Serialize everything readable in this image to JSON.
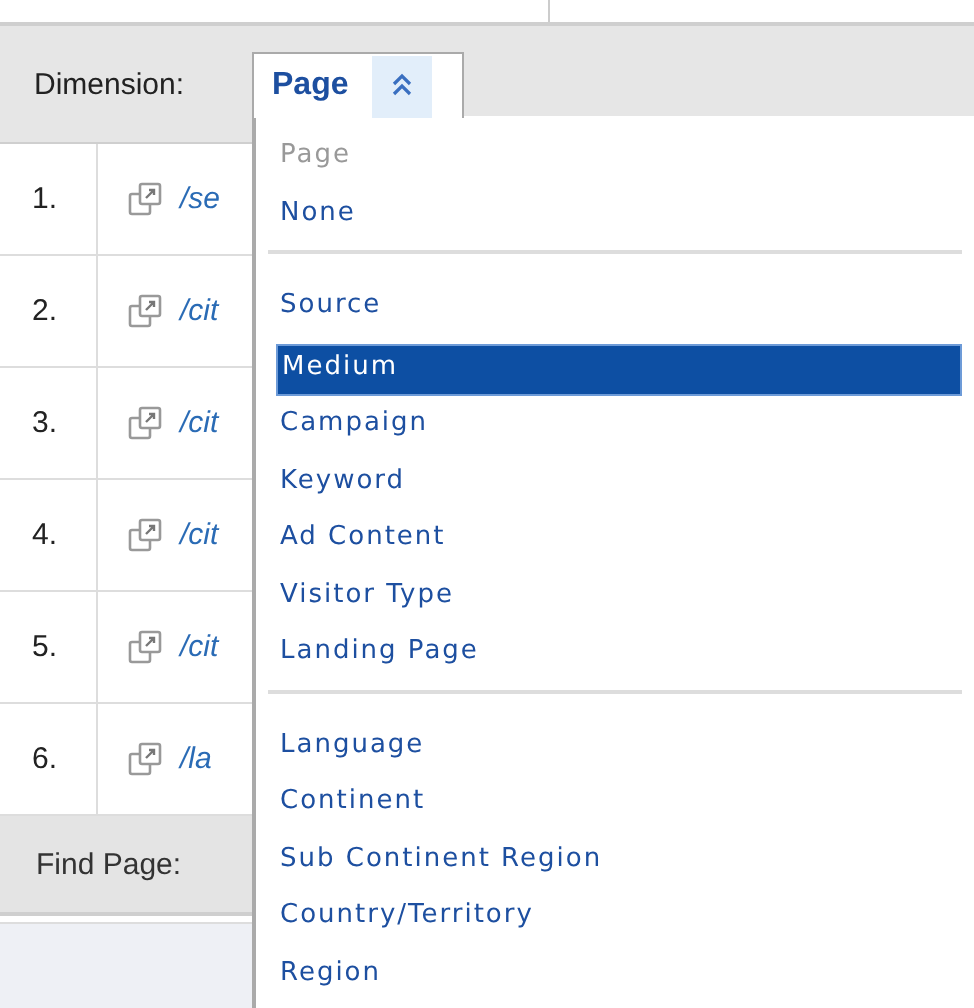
{
  "dimension_bar": {
    "label": "Dimension:",
    "dropdown": {
      "value": "Page",
      "expanded": true
    }
  },
  "table": {
    "rows": [
      {
        "number": "1.",
        "link": "/se"
      },
      {
        "number": "2.",
        "link": "/cit"
      },
      {
        "number": "3.",
        "link": "/cit"
      },
      {
        "number": "4.",
        "link": "/cit"
      },
      {
        "number": "5.",
        "link": "/cit"
      },
      {
        "number": "6.",
        "link": "/la"
      }
    ]
  },
  "find_bar": {
    "label": "Find Page:"
  },
  "menu": {
    "groups": [
      [
        {
          "label": "Page",
          "selected": false,
          "disabled": true
        },
        {
          "label": "None",
          "selected": false,
          "disabled": false
        }
      ],
      [
        {
          "label": "Source",
          "selected": false,
          "disabled": false
        },
        {
          "label": "Medium",
          "selected": true,
          "disabled": false
        },
        {
          "label": "Campaign",
          "selected": false,
          "disabled": false
        },
        {
          "label": "Keyword",
          "selected": false,
          "disabled": false
        },
        {
          "label": "Ad Content",
          "selected": false,
          "disabled": false
        },
        {
          "label": "Visitor Type",
          "selected": false,
          "disabled": false
        },
        {
          "label": "Landing Page",
          "selected": false,
          "disabled": false
        }
      ],
      [
        {
          "label": "Language",
          "selected": false,
          "disabled": false
        },
        {
          "label": "Continent",
          "selected": false,
          "disabled": false
        },
        {
          "label": "Sub Continent Region",
          "selected": false,
          "disabled": false
        },
        {
          "label": "Country/Territory",
          "selected": false,
          "disabled": false
        },
        {
          "label": "Region",
          "selected": false,
          "disabled": false
        }
      ]
    ]
  }
}
